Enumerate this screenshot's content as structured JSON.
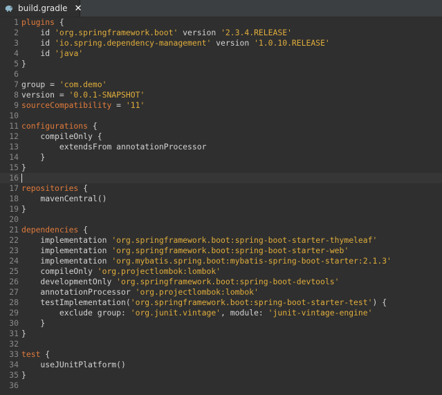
{
  "tab": {
    "title": "build.gradle",
    "close_glyph": "✕",
    "icon": "gradle-elephant-icon"
  },
  "colors": {
    "keyword": "#e07b3c",
    "string": "#e0ad3c",
    "plain": "#d4d4d4",
    "line_number": "#8a8a8a",
    "background": "#2f2f2f"
  },
  "editor": {
    "current_line": 16,
    "lines": [
      [
        [
          "kw",
          "plugins"
        ],
        [
          "pl",
          " {"
        ]
      ],
      [
        [
          "pl",
          "    id "
        ],
        [
          "str",
          "'org.springframework.boot'"
        ],
        [
          "pl",
          " version "
        ],
        [
          "str",
          "'2.3.4.RELEASE'"
        ]
      ],
      [
        [
          "pl",
          "    id "
        ],
        [
          "str",
          "'io.spring.dependency-management'"
        ],
        [
          "pl",
          " version "
        ],
        [
          "str",
          "'1.0.10.RELEASE'"
        ]
      ],
      [
        [
          "pl",
          "    id "
        ],
        [
          "str",
          "'java'"
        ]
      ],
      [
        [
          "pl",
          "}"
        ]
      ],
      [],
      [
        [
          "pl",
          "group = "
        ],
        [
          "str",
          "'com.demo'"
        ]
      ],
      [
        [
          "pl",
          "version = "
        ],
        [
          "str",
          "'0.0.1-SNAPSHOT'"
        ]
      ],
      [
        [
          "kw",
          "sourceCompatibility"
        ],
        [
          "pl",
          " = "
        ],
        [
          "str",
          "'11'"
        ]
      ],
      [],
      [
        [
          "kw",
          "configurations"
        ],
        [
          "pl",
          " {"
        ]
      ],
      [
        [
          "pl",
          "    compileOnly {"
        ]
      ],
      [
        [
          "pl",
          "        extendsFrom annotationProcessor"
        ]
      ],
      [
        [
          "pl",
          "    }"
        ]
      ],
      [
        [
          "pl",
          "}"
        ]
      ],
      [],
      [
        [
          "kw",
          "repositories"
        ],
        [
          "pl",
          " {"
        ]
      ],
      [
        [
          "pl",
          "    mavenCentral()"
        ]
      ],
      [
        [
          "pl",
          "}"
        ]
      ],
      [],
      [
        [
          "kw",
          "dependencies"
        ],
        [
          "pl",
          " {"
        ]
      ],
      [
        [
          "pl",
          "    implementation "
        ],
        [
          "str",
          "'org.springframework.boot:spring-boot-starter-thymeleaf'"
        ]
      ],
      [
        [
          "pl",
          "    implementation "
        ],
        [
          "str",
          "'org.springframework.boot:spring-boot-starter-web'"
        ]
      ],
      [
        [
          "pl",
          "    implementation "
        ],
        [
          "str",
          "'org.mybatis.spring.boot:mybatis-spring-boot-starter:2.1.3'"
        ]
      ],
      [
        [
          "pl",
          "    compileOnly "
        ],
        [
          "str",
          "'org.projectlombok:lombok'"
        ]
      ],
      [
        [
          "pl",
          "    developmentOnly "
        ],
        [
          "str",
          "'org.springframework.boot:spring-boot-devtools'"
        ]
      ],
      [
        [
          "pl",
          "    annotationProcessor "
        ],
        [
          "str",
          "'org.projectlombok:lombok'"
        ]
      ],
      [
        [
          "pl",
          "    testImplementation("
        ],
        [
          "str",
          "'org.springframework.boot:spring-boot-starter-test'"
        ],
        [
          "pl",
          ") {"
        ]
      ],
      [
        [
          "pl",
          "        exclude group: "
        ],
        [
          "str",
          "'org.junit.vintage'"
        ],
        [
          "pl",
          ", module: "
        ],
        [
          "str",
          "'junit-vintage-engine'"
        ]
      ],
      [
        [
          "pl",
          "    }"
        ]
      ],
      [
        [
          "pl",
          "}"
        ]
      ],
      [],
      [
        [
          "kw",
          "test"
        ],
        [
          "pl",
          " {"
        ]
      ],
      [
        [
          "pl",
          "    useJUnitPlatform()"
        ]
      ],
      [
        [
          "pl",
          "}"
        ]
      ],
      []
    ]
  }
}
